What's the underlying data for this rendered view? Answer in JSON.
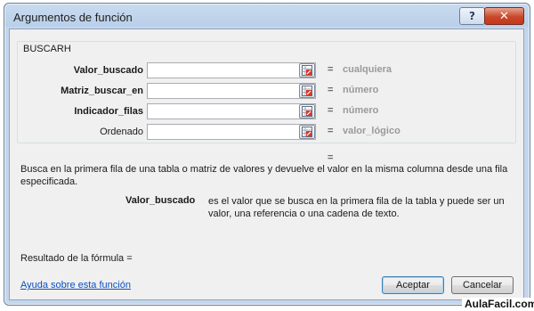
{
  "window": {
    "title": "Argumentos de función",
    "help_button": "?",
    "close_button": "✕"
  },
  "function_name": "BUSCARH",
  "arguments": [
    {
      "label": "Valor_buscado",
      "bold": true,
      "value": "",
      "equals": "=",
      "hint": "cualquiera"
    },
    {
      "label": "Matriz_buscar_en",
      "bold": true,
      "value": "",
      "equals": "=",
      "hint": "número"
    },
    {
      "label": "Indicador_filas",
      "bold": true,
      "value": "",
      "equals": "=",
      "hint": "número"
    },
    {
      "label": "Ordenado",
      "bold": false,
      "value": "",
      "equals": "=",
      "hint": "valor_lógico"
    }
  ],
  "result_equals": "=",
  "description": "Busca en la primera fila de una tabla o matriz de valores y devuelve el valor en la misma columna desde una fila especificada.",
  "argument_help": {
    "label": "Valor_buscado",
    "text": "es el valor que se busca en la primera fila de la tabla y puede ser un valor, una referencia o una cadena de texto."
  },
  "formula_result_label": "Resultado de la fórmula =",
  "help_link": "Ayuda sobre esta función",
  "buttons": {
    "accept": "Aceptar",
    "cancel": "Cancelar"
  },
  "watermark": "AulaFacil.com",
  "icons": {
    "collapse": "range-collapse-icon",
    "help": "question-icon",
    "close": "close-icon"
  }
}
